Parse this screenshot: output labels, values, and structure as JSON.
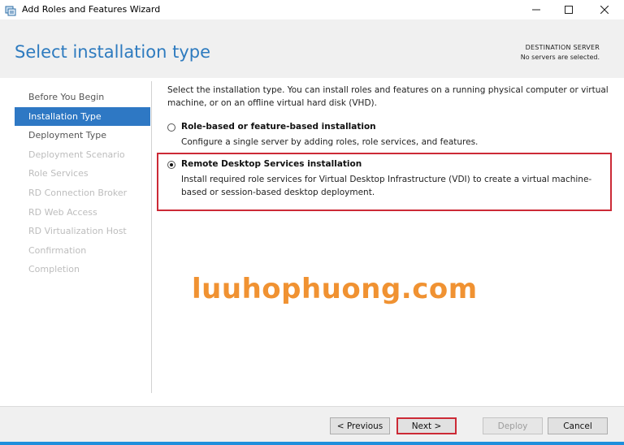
{
  "window": {
    "title": "Add Roles and Features Wizard",
    "icons": {
      "app": "server-manager-icon",
      "minimize": "minimize-icon",
      "maximize": "maximize-icon",
      "close": "close-icon"
    }
  },
  "header": {
    "title": "Select installation type",
    "destination_label": "DESTINATION SERVER",
    "destination_value": "No servers are selected."
  },
  "nav": {
    "items": [
      {
        "label": "Before You Begin",
        "state": "done"
      },
      {
        "label": "Installation Type",
        "state": "active"
      },
      {
        "label": "Deployment Type",
        "state": "done"
      },
      {
        "label": "Deployment Scenario",
        "state": "disabled"
      },
      {
        "label": "Role Services",
        "state": "disabled"
      },
      {
        "label": "RD Connection Broker",
        "state": "disabled"
      },
      {
        "label": "RD Web Access",
        "state": "disabled"
      },
      {
        "label": "RD Virtualization Host",
        "state": "disabled"
      },
      {
        "label": "Confirmation",
        "state": "disabled"
      },
      {
        "label": "Completion",
        "state": "disabled"
      }
    ]
  },
  "main": {
    "description": "Select the installation type. You can install roles and features on a running physical computer or virtual machine, or on an offline virtual hard disk (VHD).",
    "options": [
      {
        "title": "Role-based or feature-based installation",
        "desc": "Configure a single server by adding roles, role services, and features.",
        "selected": false
      },
      {
        "title": "Remote Desktop Services installation",
        "desc": "Install required role services for Virtual Desktop Infrastructure (VDI) to create a virtual machine-based or session-based desktop deployment.",
        "selected": true
      }
    ]
  },
  "watermark": "luuhophuong.com",
  "buttons": {
    "previous": "< Previous",
    "next": "Next >",
    "deploy": "Deploy",
    "cancel": "Cancel"
  },
  "colors": {
    "accent": "#2e78c4",
    "title": "#2e7bbf",
    "highlight": "#cc2a36",
    "watermark": "#f09232"
  }
}
